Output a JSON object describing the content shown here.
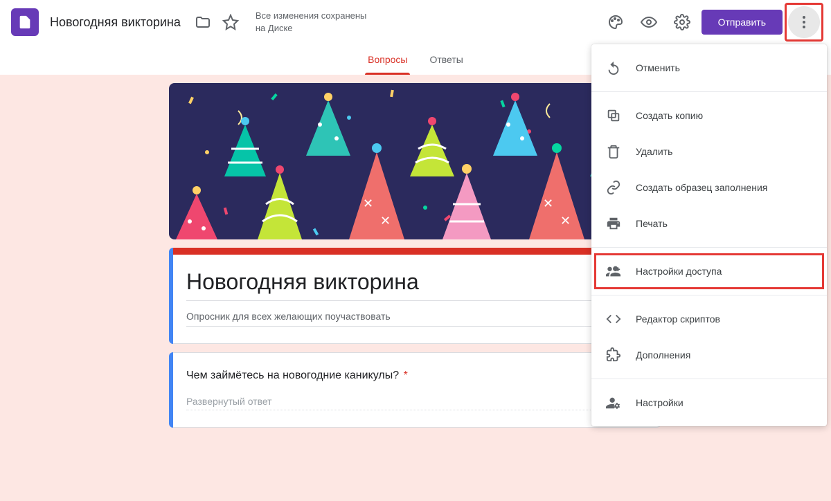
{
  "header": {
    "doc_title": "Новогодняя викторина",
    "save_status_line1": "Все изменения сохранены",
    "save_status_line2": "на Диске",
    "send_label": "Отправить"
  },
  "tabs": {
    "questions": "Вопросы",
    "responses": "Ответы"
  },
  "form": {
    "title": "Новогодняя викторина",
    "description": "Опросник для всех желающих поучаствовать"
  },
  "question": {
    "title": "Чем займётесь на новогодние каникулы?",
    "required_mark": "*",
    "placeholder": "Развернутый ответ"
  },
  "menu": {
    "undo": "Отменить",
    "copy": "Создать копию",
    "delete": "Удалить",
    "prefill": "Создать образец заполнения",
    "print": "Печать",
    "sharing": "Настройки доступа",
    "script_editor": "Редактор скриптов",
    "addons": "Дополнения",
    "settings": "Настройки"
  }
}
